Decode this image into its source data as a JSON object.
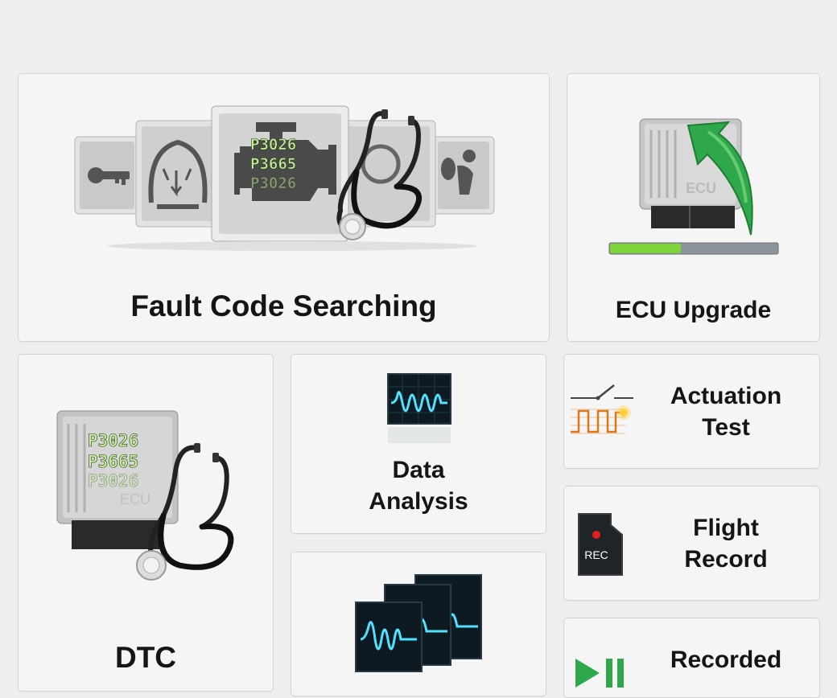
{
  "tiles": {
    "fault_code_searching": {
      "label": "Fault Code Searching",
      "codes": [
        "P3026",
        "P3665",
        "P3026"
      ]
    },
    "ecu_upgrade": {
      "label": "ECU Upgrade",
      "chip_text": "ECU",
      "progress": 0.42
    },
    "dtc": {
      "label": "DTC",
      "codes": [
        "P3026",
        "P3665",
        "P3026"
      ],
      "chip_text": "ECU"
    },
    "data_analysis": {
      "line1": "Data",
      "line2": "Analysis"
    },
    "actuation_test": {
      "line1": "Actuation",
      "line2": "Test"
    },
    "flight_record": {
      "line1": "Flight",
      "line2": "Record",
      "sd_text": "REC"
    },
    "recorded": {
      "line1": "Recorded"
    }
  },
  "colors": {
    "background": "#eeeeee",
    "tile": "#f5f5f5",
    "accent_green": "#2ea84a",
    "wave_cyan": "#4fe3ff",
    "rec_red": "#e0201a",
    "code_green": "#c8f0a0"
  },
  "icons": [
    "car-key-icon",
    "tpms-icon",
    "engine-icon",
    "stethoscope-icon",
    "airbag-icon",
    "ecu-icon",
    "upgrade-arrow-icon",
    "waveform-icon",
    "actuator-switch-icon",
    "sd-card-icon",
    "play-pause-icon"
  ]
}
